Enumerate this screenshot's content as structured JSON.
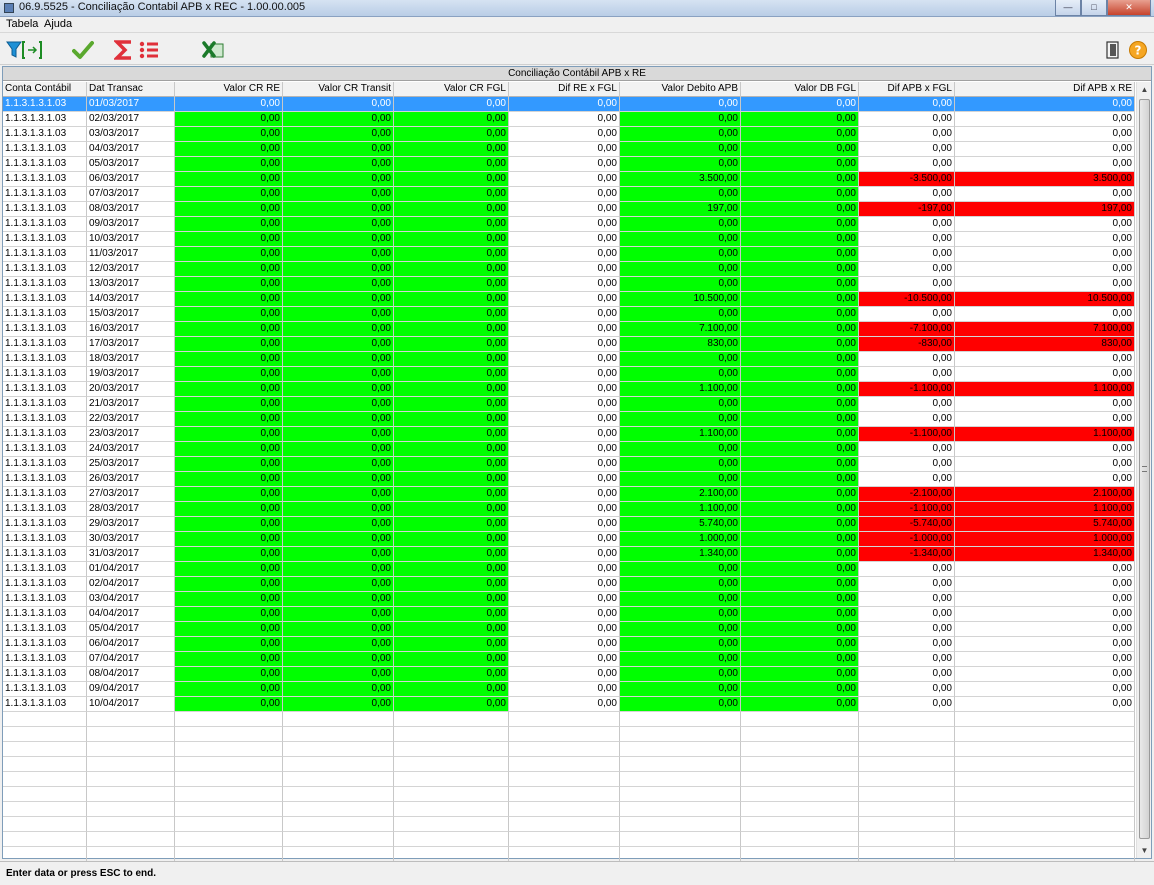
{
  "window": {
    "title": "06.9.5525 - Conciliação Contabil APB x REC - 1.00.00.005"
  },
  "menu": {
    "items": [
      "Tabela",
      "Ajuda"
    ]
  },
  "toolbar": {
    "icons": [
      "filter-icon",
      "check-icon",
      "sum-icon",
      "list-icon",
      "excel-icon",
      "exit-icon",
      "help-icon"
    ],
    "help_label": "?"
  },
  "grid": {
    "title": "Conciliação Contábil APB x RE",
    "columns": [
      "Conta Contábil",
      "Dat Transac",
      "Valor CR RE",
      "Valor CR Transit",
      "Valor CR FGL",
      "Dif RE x FGL",
      "Valor Debito APB",
      "Valor DB FGL",
      "Dif APB x FGL",
      "Dif APB x RE"
    ],
    "selected_row": 0,
    "rows": [
      [
        "1.1.3.1.3.1.03",
        "01/03/2017",
        "0,00",
        "0,00",
        "0,00",
        "0,00",
        "0,00",
        "0,00",
        "0,00",
        "0,00"
      ],
      [
        "1.1.3.1.3.1.03",
        "02/03/2017",
        "0,00",
        "0,00",
        "0,00",
        "0,00",
        "0,00",
        "0,00",
        "0,00",
        "0,00"
      ],
      [
        "1.1.3.1.3.1.03",
        "03/03/2017",
        "0,00",
        "0,00",
        "0,00",
        "0,00",
        "0,00",
        "0,00",
        "0,00",
        "0,00"
      ],
      [
        "1.1.3.1.3.1.03",
        "04/03/2017",
        "0,00",
        "0,00",
        "0,00",
        "0,00",
        "0,00",
        "0,00",
        "0,00",
        "0,00"
      ],
      [
        "1.1.3.1.3.1.03",
        "05/03/2017",
        "0,00",
        "0,00",
        "0,00",
        "0,00",
        "0,00",
        "0,00",
        "0,00",
        "0,00"
      ],
      [
        "1.1.3.1.3.1.03",
        "06/03/2017",
        "0,00",
        "0,00",
        "0,00",
        "0,00",
        "3.500,00",
        "0,00",
        "-3.500,00",
        "3.500,00"
      ],
      [
        "1.1.3.1.3.1.03",
        "07/03/2017",
        "0,00",
        "0,00",
        "0,00",
        "0,00",
        "0,00",
        "0,00",
        "0,00",
        "0,00"
      ],
      [
        "1.1.3.1.3.1.03",
        "08/03/2017",
        "0,00",
        "0,00",
        "0,00",
        "0,00",
        "197,00",
        "0,00",
        "-197,00",
        "197,00"
      ],
      [
        "1.1.3.1.3.1.03",
        "09/03/2017",
        "0,00",
        "0,00",
        "0,00",
        "0,00",
        "0,00",
        "0,00",
        "0,00",
        "0,00"
      ],
      [
        "1.1.3.1.3.1.03",
        "10/03/2017",
        "0,00",
        "0,00",
        "0,00",
        "0,00",
        "0,00",
        "0,00",
        "0,00",
        "0,00"
      ],
      [
        "1.1.3.1.3.1.03",
        "11/03/2017",
        "0,00",
        "0,00",
        "0,00",
        "0,00",
        "0,00",
        "0,00",
        "0,00",
        "0,00"
      ],
      [
        "1.1.3.1.3.1.03",
        "12/03/2017",
        "0,00",
        "0,00",
        "0,00",
        "0,00",
        "0,00",
        "0,00",
        "0,00",
        "0,00"
      ],
      [
        "1.1.3.1.3.1.03",
        "13/03/2017",
        "0,00",
        "0,00",
        "0,00",
        "0,00",
        "0,00",
        "0,00",
        "0,00",
        "0,00"
      ],
      [
        "1.1.3.1.3.1.03",
        "14/03/2017",
        "0,00",
        "0,00",
        "0,00",
        "0,00",
        "10.500,00",
        "0,00",
        "-10.500,00",
        "10.500,00"
      ],
      [
        "1.1.3.1.3.1.03",
        "15/03/2017",
        "0,00",
        "0,00",
        "0,00",
        "0,00",
        "0,00",
        "0,00",
        "0,00",
        "0,00"
      ],
      [
        "1.1.3.1.3.1.03",
        "16/03/2017",
        "0,00",
        "0,00",
        "0,00",
        "0,00",
        "7.100,00",
        "0,00",
        "-7.100,00",
        "7.100,00"
      ],
      [
        "1.1.3.1.3.1.03",
        "17/03/2017",
        "0,00",
        "0,00",
        "0,00",
        "0,00",
        "830,00",
        "0,00",
        "-830,00",
        "830,00"
      ],
      [
        "1.1.3.1.3.1.03",
        "18/03/2017",
        "0,00",
        "0,00",
        "0,00",
        "0,00",
        "0,00",
        "0,00",
        "0,00",
        "0,00"
      ],
      [
        "1.1.3.1.3.1.03",
        "19/03/2017",
        "0,00",
        "0,00",
        "0,00",
        "0,00",
        "0,00",
        "0,00",
        "0,00",
        "0,00"
      ],
      [
        "1.1.3.1.3.1.03",
        "20/03/2017",
        "0,00",
        "0,00",
        "0,00",
        "0,00",
        "1.100,00",
        "0,00",
        "-1.100,00",
        "1.100,00"
      ],
      [
        "1.1.3.1.3.1.03",
        "21/03/2017",
        "0,00",
        "0,00",
        "0,00",
        "0,00",
        "0,00",
        "0,00",
        "0,00",
        "0,00"
      ],
      [
        "1.1.3.1.3.1.03",
        "22/03/2017",
        "0,00",
        "0,00",
        "0,00",
        "0,00",
        "0,00",
        "0,00",
        "0,00",
        "0,00"
      ],
      [
        "1.1.3.1.3.1.03",
        "23/03/2017",
        "0,00",
        "0,00",
        "0,00",
        "0,00",
        "1.100,00",
        "0,00",
        "-1.100,00",
        "1.100,00"
      ],
      [
        "1.1.3.1.3.1.03",
        "24/03/2017",
        "0,00",
        "0,00",
        "0,00",
        "0,00",
        "0,00",
        "0,00",
        "0,00",
        "0,00"
      ],
      [
        "1.1.3.1.3.1.03",
        "25/03/2017",
        "0,00",
        "0,00",
        "0,00",
        "0,00",
        "0,00",
        "0,00",
        "0,00",
        "0,00"
      ],
      [
        "1.1.3.1.3.1.03",
        "26/03/2017",
        "0,00",
        "0,00",
        "0,00",
        "0,00",
        "0,00",
        "0,00",
        "0,00",
        "0,00"
      ],
      [
        "1.1.3.1.3.1.03",
        "27/03/2017",
        "0,00",
        "0,00",
        "0,00",
        "0,00",
        "2.100,00",
        "0,00",
        "-2.100,00",
        "2.100,00"
      ],
      [
        "1.1.3.1.3.1.03",
        "28/03/2017",
        "0,00",
        "0,00",
        "0,00",
        "0,00",
        "1.100,00",
        "0,00",
        "-1.100,00",
        "1.100,00"
      ],
      [
        "1.1.3.1.3.1.03",
        "29/03/2017",
        "0,00",
        "0,00",
        "0,00",
        "0,00",
        "5.740,00",
        "0,00",
        "-5.740,00",
        "5.740,00"
      ],
      [
        "1.1.3.1.3.1.03",
        "30/03/2017",
        "0,00",
        "0,00",
        "0,00",
        "0,00",
        "1.000,00",
        "0,00",
        "-1.000,00",
        "1.000,00"
      ],
      [
        "1.1.3.1.3.1.03",
        "31/03/2017",
        "0,00",
        "0,00",
        "0,00",
        "0,00",
        "1.340,00",
        "0,00",
        "-1.340,00",
        "1.340,00"
      ],
      [
        "1.1.3.1.3.1.03",
        "01/04/2017",
        "0,00",
        "0,00",
        "0,00",
        "0,00",
        "0,00",
        "0,00",
        "0,00",
        "0,00"
      ],
      [
        "1.1.3.1.3.1.03",
        "02/04/2017",
        "0,00",
        "0,00",
        "0,00",
        "0,00",
        "0,00",
        "0,00",
        "0,00",
        "0,00"
      ],
      [
        "1.1.3.1.3.1.03",
        "03/04/2017",
        "0,00",
        "0,00",
        "0,00",
        "0,00",
        "0,00",
        "0,00",
        "0,00",
        "0,00"
      ],
      [
        "1.1.3.1.3.1.03",
        "04/04/2017",
        "0,00",
        "0,00",
        "0,00",
        "0,00",
        "0,00",
        "0,00",
        "0,00",
        "0,00"
      ],
      [
        "1.1.3.1.3.1.03",
        "05/04/2017",
        "0,00",
        "0,00",
        "0,00",
        "0,00",
        "0,00",
        "0,00",
        "0,00",
        "0,00"
      ],
      [
        "1.1.3.1.3.1.03",
        "06/04/2017",
        "0,00",
        "0,00",
        "0,00",
        "0,00",
        "0,00",
        "0,00",
        "0,00",
        "0,00"
      ],
      [
        "1.1.3.1.3.1.03",
        "07/04/2017",
        "0,00",
        "0,00",
        "0,00",
        "0,00",
        "0,00",
        "0,00",
        "0,00",
        "0,00"
      ],
      [
        "1.1.3.1.3.1.03",
        "08/04/2017",
        "0,00",
        "0,00",
        "0,00",
        "0,00",
        "0,00",
        "0,00",
        "0,00",
        "0,00"
      ],
      [
        "1.1.3.1.3.1.03",
        "09/04/2017",
        "0,00",
        "0,00",
        "0,00",
        "0,00",
        "0,00",
        "0,00",
        "0,00",
        "0,00"
      ],
      [
        "1.1.3.1.3.1.03",
        "10/04/2017",
        "0,00",
        "0,00",
        "0,00",
        "0,00",
        "0,00",
        "0,00",
        "0,00",
        "0,00"
      ]
    ]
  },
  "colors": {
    "match": "#00ff00",
    "mismatch": "#ff0000",
    "selection": "#3399ff"
  },
  "status": {
    "text": "Enter data or press ESC to end."
  }
}
